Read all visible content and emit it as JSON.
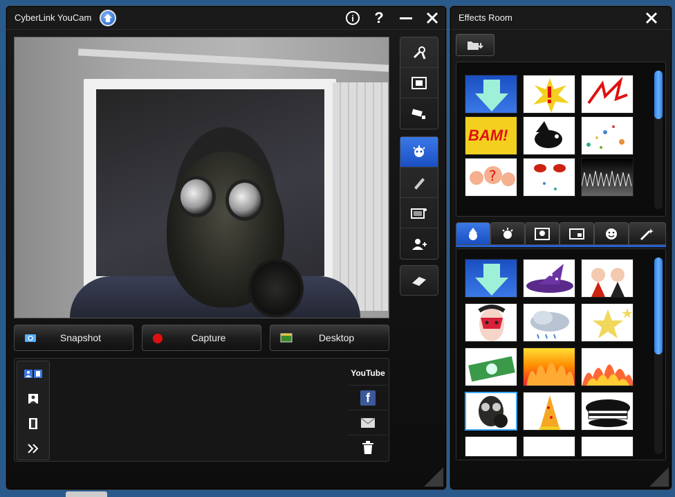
{
  "main_window": {
    "title": "CyberLink YouCam",
    "title_buttons": [
      "info-icon",
      "help-icon",
      "minimize-icon",
      "close-icon"
    ],
    "help_label": "?",
    "info_label": "i"
  },
  "side_tools": {
    "group1": [
      "settings-icon",
      "fullscreen-icon",
      "webcam-settings-icon"
    ],
    "group2": [
      "effects-icon",
      "draw-icon",
      "scene-icon",
      "face-tracking-icon"
    ],
    "group3": [
      "eraser-icon"
    ],
    "active": "effects-icon"
  },
  "actions": {
    "snapshot": "Snapshot",
    "capture": "Capture",
    "desktop": "Desktop"
  },
  "library": {
    "tabs": [
      "all-media-icon",
      "photo-icon",
      "video-icon",
      "expand-icon"
    ],
    "share": {
      "youtube": "YouTube",
      "facebook": "f"
    }
  },
  "effects_room": {
    "title": "Effects Room",
    "top_thumbs": [
      "Download",
      "Explosion",
      "Lightning",
      "BAM!",
      "Bird",
      "Confetti",
      "Question marks",
      "Lips",
      "Waves"
    ],
    "bam_text": "BAM!",
    "category_tabs": [
      "hat-icon",
      "face-icon",
      "frame-icon",
      "screen-icon",
      "smiley-icon",
      "wand-icon"
    ],
    "active_category": "hat-icon",
    "bottom_thumbs": [
      "Download",
      "Witch hat",
      "Angels",
      "Opera mask",
      "Clouds",
      "Stars",
      "Money",
      "Fire",
      "Fire 2",
      "Gas mask",
      "Party hat",
      "Police cap"
    ],
    "selected": "Gas mask"
  },
  "colors": {
    "accent": "#2561d0",
    "background": "#0d0d0d",
    "selection": "#3aa8ff",
    "record_red": "#e01010"
  }
}
